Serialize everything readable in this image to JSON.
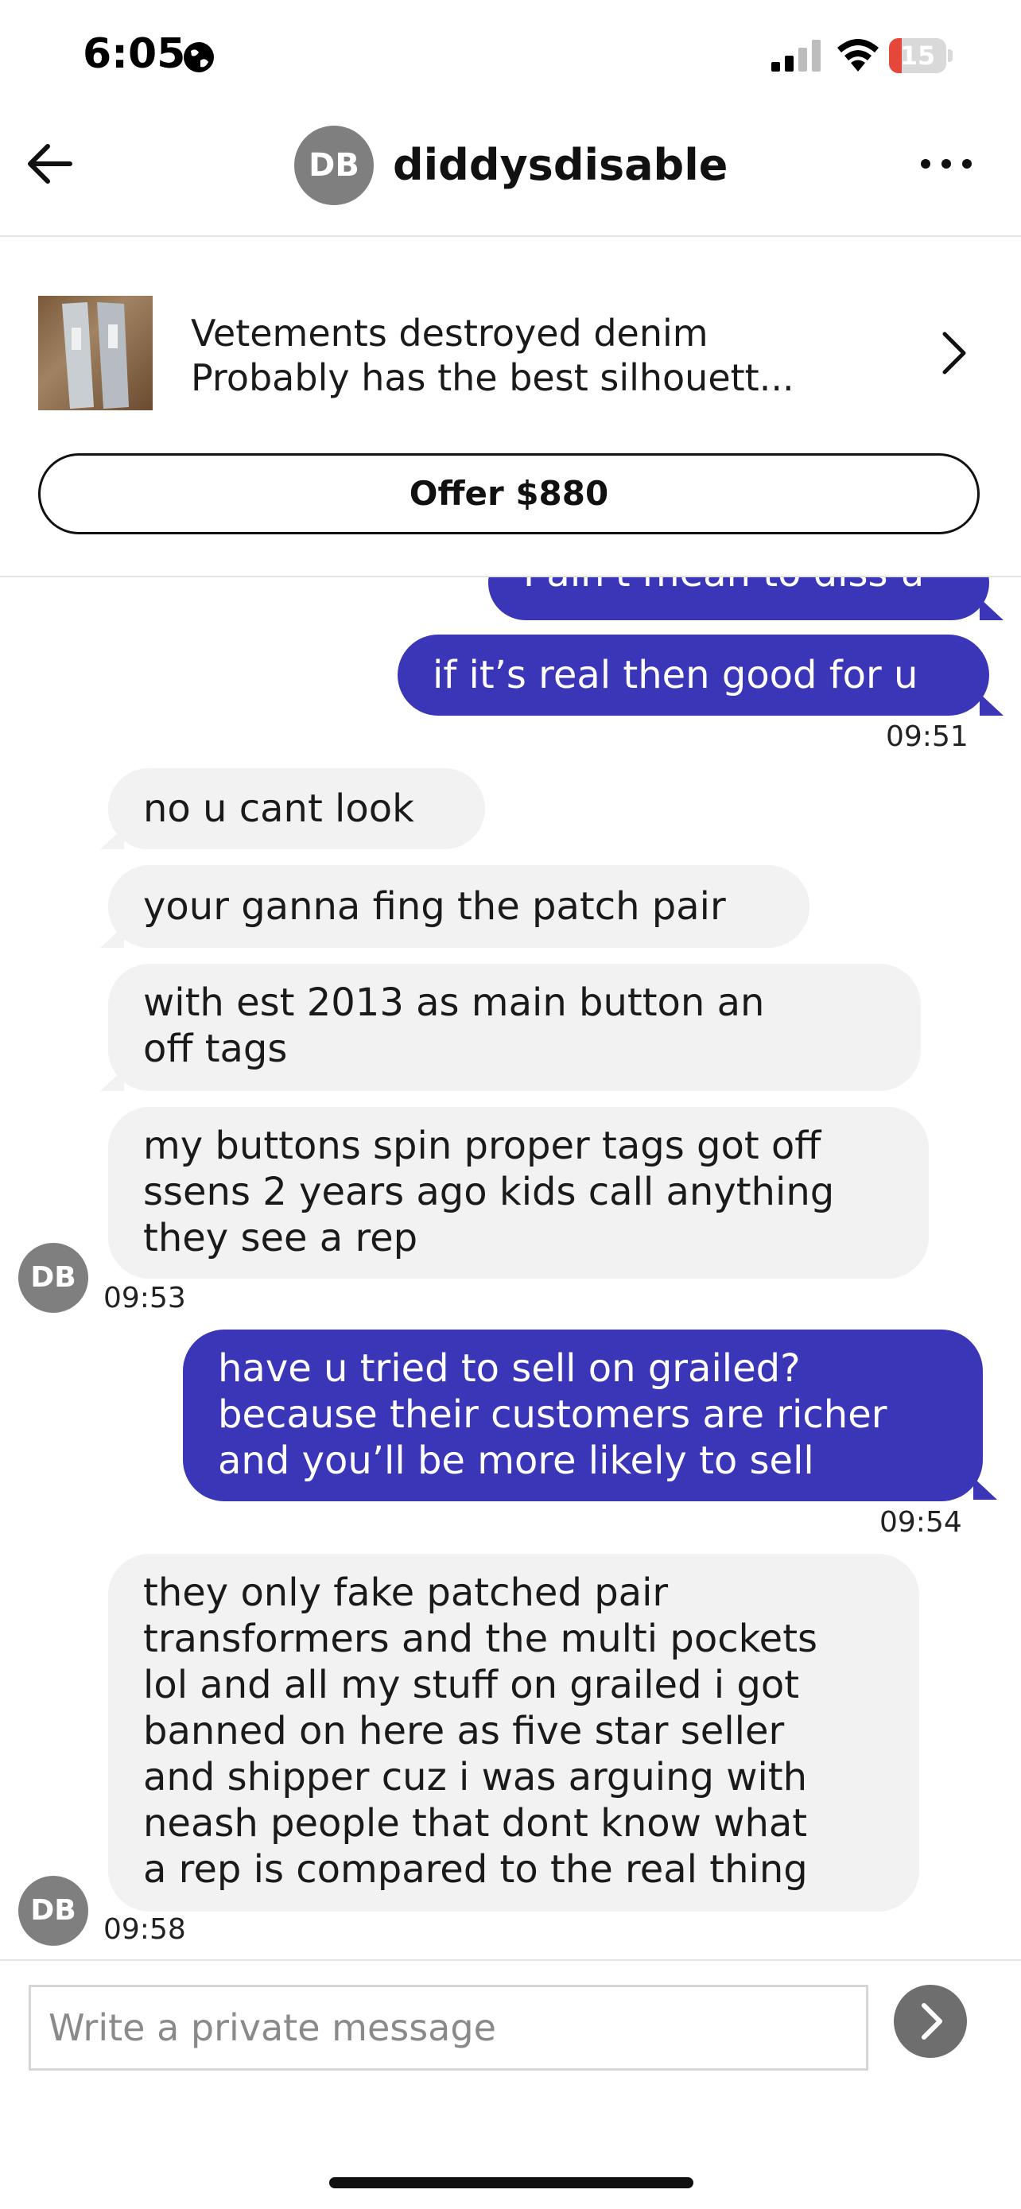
{
  "status_bar": {
    "time": "6:05",
    "battery": "15",
    "icons": [
      "globe-icon",
      "signal-icon",
      "wifi-icon",
      "battery-icon"
    ]
  },
  "header": {
    "avatar_initials": "DB",
    "username": "diddysdisable",
    "back_icon": "arrow-left-icon",
    "more_icon": "more-horizontal-icon"
  },
  "listing": {
    "title": "Vetements destroyed denim",
    "subtitle": "Probably has the best silhouett...",
    "chevron_icon": "chevron-right-icon",
    "offer_label": "Offer $880"
  },
  "messages": {
    "sent_partial": "I ain't mean to diss u",
    "sent_1": "if it’s real then good for u",
    "time_1": "09:51",
    "recv_1": "no u cant look",
    "recv_2": "your ganna fing the patch pair",
    "recv_3": "with est 2013 as main button an\noff tags",
    "recv_4": "my buttons spin proper tags got off\nssens 2 years ago kids call anything\nthey see a rep",
    "recv_avatar_1": "DB",
    "time_2": "09:53",
    "sent_2": "have u tried to sell on grailed?\nbecause their customers are richer\nand you’ll be more likely to sell",
    "time_3": "09:54",
    "recv_5": "they only fake patched pair\ntransformers and the multi pockets\nlol and all my stuff on grailed i got\nbanned on here as five star seller\nand shipper cuz i was arguing with\nneash people that dont know what\na rep is compared to the real thing",
    "recv_avatar_2": "DB",
    "time_4": "09:58"
  },
  "composer": {
    "placeholder": "Write a private message",
    "send_icon": "send-arrow-icon"
  },
  "colors": {
    "sent_bubble": "#3b35b8",
    "received_bubble": "#f2f2f2",
    "avatar": "#7f7f7f"
  }
}
